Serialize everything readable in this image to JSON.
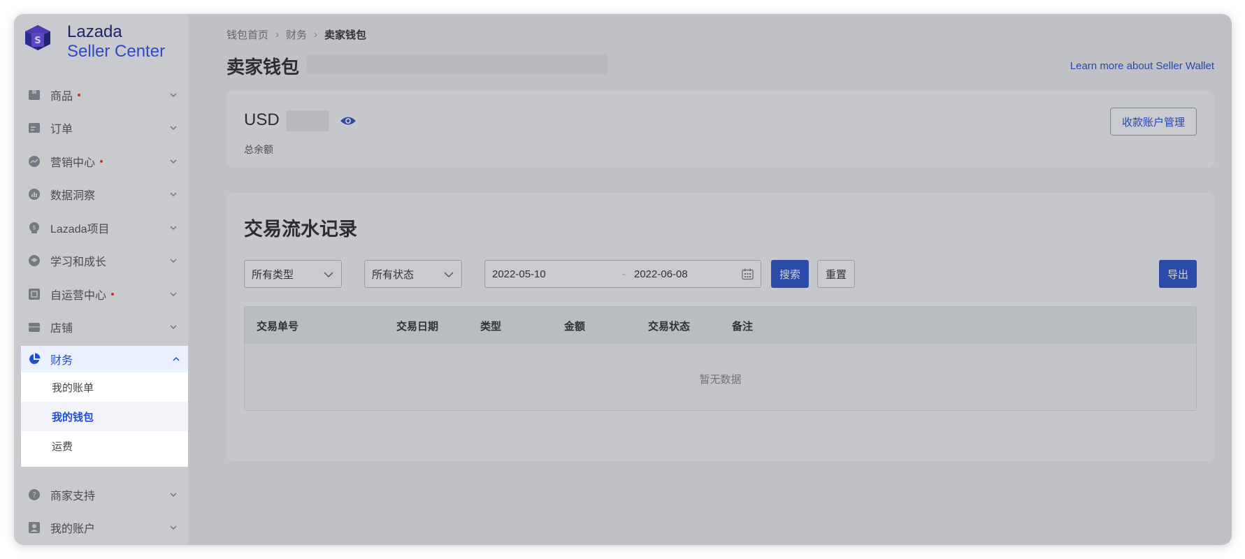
{
  "brand": {
    "line1": "Lazada",
    "line2": "Seller Center"
  },
  "sidebar": {
    "items": [
      {
        "label": "商品",
        "icon": "product-icon",
        "dot": true
      },
      {
        "label": "订单",
        "icon": "order-icon",
        "dot": false
      },
      {
        "label": "营销中心",
        "icon": "marketing-icon",
        "dot": true
      },
      {
        "label": "数据洞察",
        "icon": "data-insight-icon",
        "dot": false
      },
      {
        "label": "Lazada项目",
        "icon": "lazada-program-icon",
        "dot": false
      },
      {
        "label": "学习和成长",
        "icon": "learning-icon",
        "dot": false
      },
      {
        "label": "自运营中心",
        "icon": "self-operation-icon",
        "dot": true
      },
      {
        "label": "店铺",
        "icon": "store-icon",
        "dot": false
      }
    ],
    "finance": {
      "label": "财务",
      "icon": "pie-chart-icon",
      "children": [
        {
          "label": "我的账单"
        },
        {
          "label": "我的钱包",
          "active": true
        },
        {
          "label": "运费"
        }
      ]
    },
    "after_items": [
      {
        "label": "商家支持",
        "icon": "help-icon"
      },
      {
        "label": "我的账户",
        "icon": "account-icon"
      }
    ]
  },
  "breadcrumb": {
    "home": "钱包首页",
    "parent": "财务",
    "current": "卖家钱包"
  },
  "page": {
    "title": "卖家钱包",
    "learn_more": "Learn more about Seller Wallet"
  },
  "balance": {
    "currency": "USD",
    "label": "总余额",
    "manage_button": "收款账户管理"
  },
  "transactions": {
    "title": "交易流水记录",
    "type_filter": "所有类型",
    "status_filter": "所有状态",
    "date_start": "2022-05-10",
    "date_end": "2022-06-08",
    "date_separator": "-",
    "search_button": "搜索",
    "reset_button": "重置",
    "export_button": "导出",
    "columns": [
      "交易单号",
      "交易日期",
      "类型",
      "金额",
      "交易状态",
      "备注"
    ],
    "empty_text": "暂无数据"
  },
  "colors": {
    "accent": "#2e52c7",
    "highlight": "#eaf0fd",
    "badge_dot": "#e23838"
  }
}
